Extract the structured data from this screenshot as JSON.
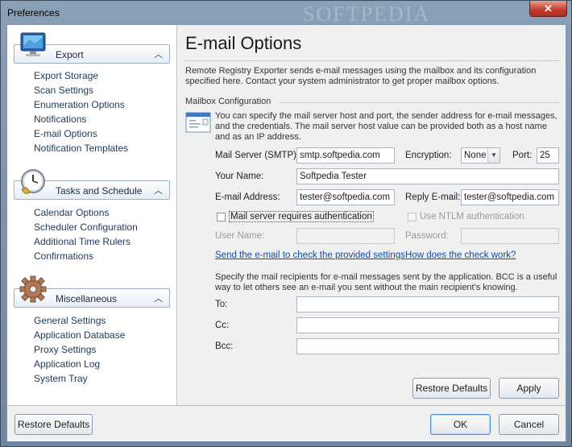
{
  "window": {
    "title": "Preferences",
    "watermark": "SOFTPEDIA",
    "close_glyph": "✕"
  },
  "sidebar": {
    "groups": [
      {
        "label": "Export",
        "icon": "monitor-icon",
        "items": [
          "Export Storage",
          "Scan Settings",
          "Enumeration Options",
          "Notifications",
          "E-mail Options",
          "Notification Templates"
        ]
      },
      {
        "label": "Tasks and Schedule",
        "icon": "clock-icon",
        "items": [
          "Calendar Options",
          "Scheduler Configuration",
          "Additional Time Rulers",
          "Confirmations"
        ]
      },
      {
        "label": "Miscellaneous",
        "icon": "gear-icon",
        "items": [
          "General Settings",
          "Application Database",
          "Proxy Settings",
          "Application Log",
          "System Tray"
        ]
      }
    ]
  },
  "main": {
    "title": "E-mail Options",
    "intro": "Remote Registry Exporter sends e-mail messages using the mailbox and its configuration specified here. Contact your system administrator to get proper mailbox options.",
    "mailbox_section": "Mailbox Configuration",
    "mailbox_desc": "You can specify the mail server host and port, the sender address for e-mail messages, and the credentials. The mail server host value can be provided both as a host name and as an IP address.",
    "labels": {
      "mail_server": "Mail Server (SMTP):",
      "encryption": "Encryption:",
      "port": "Port:",
      "your_name": "Your Name:",
      "email_address": "E-mail Address:",
      "reply_email": "Reply E-mail:",
      "requires_auth": "Mail server requires authentication",
      "use_ntlm": "Use NTLM authentication",
      "user_name": "User Name:",
      "password": "Password:",
      "to": "To:",
      "cc": "Cc:",
      "bcc": "Bcc:"
    },
    "values": {
      "mail_server": "smtp.softpedia.com",
      "encryption": "None",
      "port": "25",
      "your_name": "Softpedia Tester",
      "email_address": "tester@softpedia.com",
      "reply_email": "tester@softpedia.com",
      "user_name": "",
      "password": "",
      "to": "",
      "cc": "",
      "bcc": ""
    },
    "checkboxes": {
      "requires_auth": false,
      "use_ntlm": false
    },
    "links": {
      "send_test": "Send the e-mail to check the provided settings",
      "how_check": "How does the check work?"
    },
    "recipients_desc": "Specify the mail recipients for e-mail messages sent by the application. BCC is a useful way to let others see an e-mail you sent without the main recipient's knowing.",
    "buttons": {
      "restore_defaults": "Restore Defaults",
      "apply": "Apply"
    }
  },
  "footer": {
    "restore_defaults": "Restore Defaults",
    "ok": "OK",
    "cancel": "Cancel"
  },
  "colors": {
    "link": "#0b4fa8",
    "accent": "#4f8fd0",
    "close_button": "#c0392b"
  }
}
